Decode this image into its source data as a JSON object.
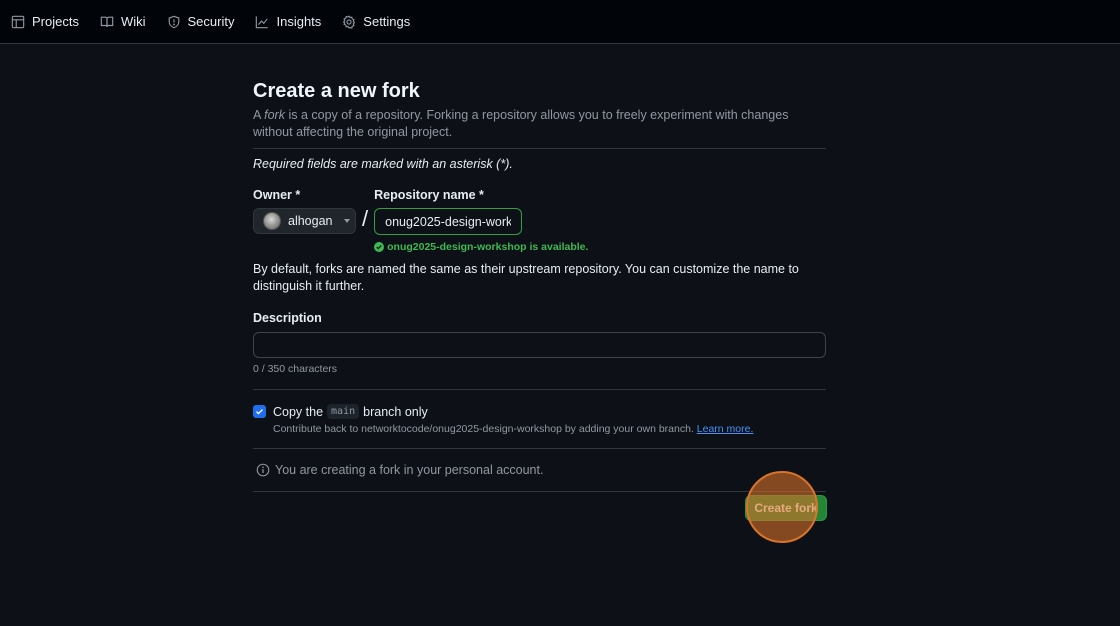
{
  "nav": {
    "items": [
      {
        "label": "Projects",
        "icon": "table-icon"
      },
      {
        "label": "Wiki",
        "icon": "book-icon"
      },
      {
        "label": "Security",
        "icon": "shield-icon"
      },
      {
        "label": "Insights",
        "icon": "graph-icon"
      },
      {
        "label": "Settings",
        "icon": "gear-icon"
      }
    ]
  },
  "page": {
    "title": "Create a new fork",
    "intro_prefix": "A ",
    "intro_fork": "fork",
    "intro_rest": " is a copy of a repository. Forking a repository allows you to freely experiment with changes without affecting the original project.",
    "required_note": "Required fields are marked with an asterisk (*)."
  },
  "owner": {
    "label": "Owner *",
    "value": "alhogan"
  },
  "separator": "/",
  "repo": {
    "label": "Repository name *",
    "value": "onug2025-design-workshop",
    "availability": "onug2025-design-workshop is available."
  },
  "default_note": "By default, forks are named the same as their upstream repository. You can customize the name to distinguish it further.",
  "description": {
    "label": "Description",
    "value": "",
    "count": "0 / 350 characters"
  },
  "copy_branch": {
    "checked": true,
    "prefix": "Copy the",
    "branch": "main",
    "suffix": "branch only",
    "contrib_text": "Contribute back to networktocode/onug2025-design-workshop by adding your own branch.",
    "learn_more": "Learn more."
  },
  "info": "You are creating a fork in your personal account.",
  "create_button": "Create fork",
  "colors": {
    "accent_green": "#238636",
    "check_blue": "#1f6feb",
    "available_green": "#3fb950",
    "link_blue": "#4493f8",
    "click_marker": "#d9742a"
  }
}
